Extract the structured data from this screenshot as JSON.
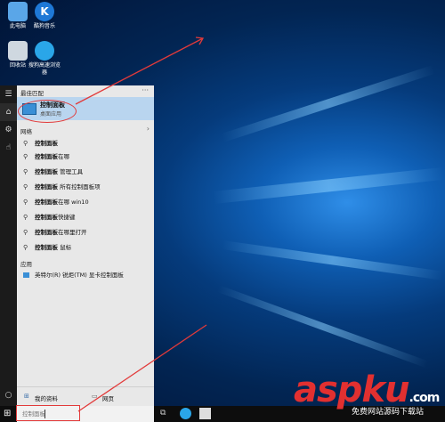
{
  "desktop": {
    "icons": [
      {
        "label": "此电脑"
      },
      {
        "label": "酷狗音乐"
      },
      {
        "label": "回收站"
      },
      {
        "label": "搜狗高速浏览器"
      }
    ]
  },
  "start_menu": {
    "best_match_header": "最佳匹配",
    "more_label": "···",
    "best_match": {
      "title": "控制面板",
      "subtitle": "桌面应用"
    },
    "web_header": "网络",
    "web_items": [
      {
        "bold": "控制面板",
        "rest": ""
      },
      {
        "bold": "控制面板",
        "rest": "在哪"
      },
      {
        "bold": "控制面板",
        "rest": " 管理工具"
      },
      {
        "bold": "控制面板",
        "rest": " 所有控制面板项"
      },
      {
        "bold": "控制面板",
        "rest": "在哪 win10"
      },
      {
        "bold": "控制面板",
        "rest": "快捷键"
      },
      {
        "bold": "控制面板",
        "rest": "在哪里打开"
      },
      {
        "bold": "控制面板",
        "rest": " 鼠标"
      }
    ],
    "apps_header": "应用",
    "app_item": "英特尔(R) 锐炬(TM) 显卡控制面板",
    "footer": {
      "my_stuff": "我的资料",
      "web": "网页"
    }
  },
  "taskbar": {
    "search_value": "控制面板"
  },
  "watermark": {
    "main": "aspku",
    "domain": ".com",
    "sub": "免费网站源码下载站"
  },
  "colors": {
    "accent": "#3a8fd6",
    "annotation": "#e23a3a",
    "selection": "#b9d5ef"
  }
}
